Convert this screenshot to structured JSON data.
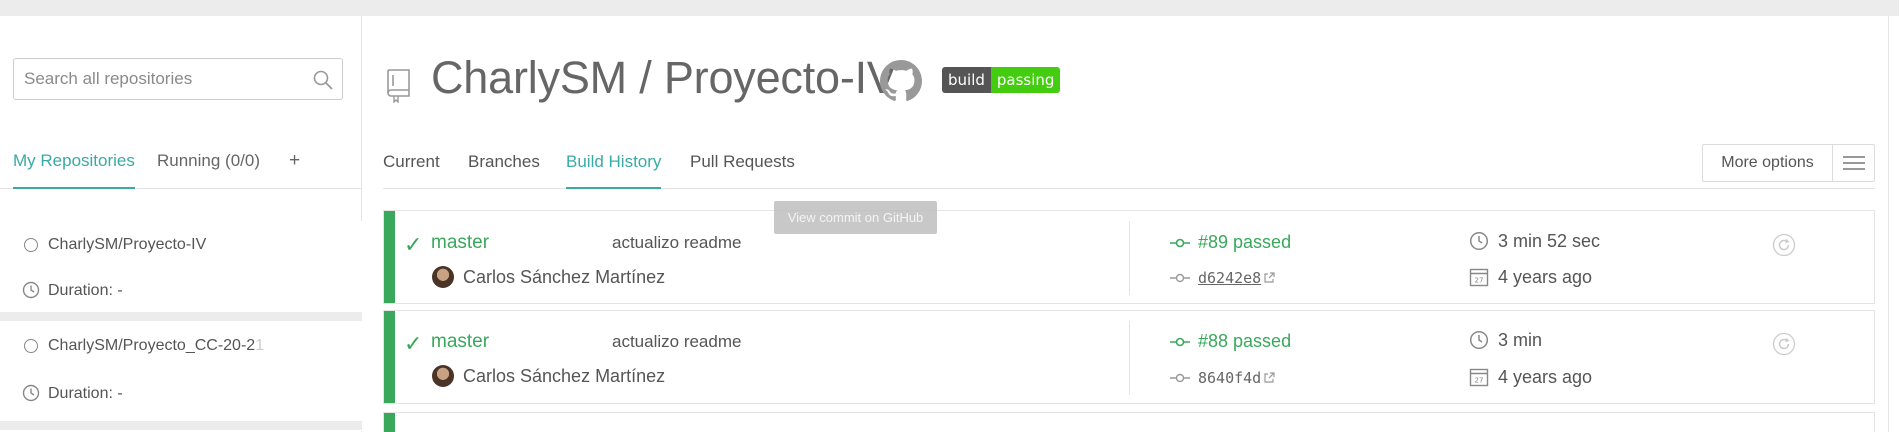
{
  "search": {
    "placeholder": "Search all repositories"
  },
  "sidebar": {
    "tabs": [
      {
        "label": "My Repositories"
      },
      {
        "label": "Running (0/0)"
      },
      {
        "label": "+"
      }
    ],
    "repos": [
      {
        "name": "CharlySM/Proyecto-IV",
        "duration": "Duration: -"
      },
      {
        "name": "CharlySM/Proyecto_CC-20-2",
        "name_fade": "1",
        "duration": "Duration: -"
      }
    ]
  },
  "header": {
    "title": "CharlySM / Proyecto-IV",
    "badge_left": "build",
    "badge_right": "passing"
  },
  "tabs": [
    {
      "label": "Current"
    },
    {
      "label": "Branches"
    },
    {
      "label": "Build History"
    },
    {
      "label": "Pull Requests"
    }
  ],
  "more_options": {
    "label": "More options"
  },
  "tooltip": "View commit on GitHub",
  "builds": [
    {
      "branch": "master",
      "message": "actualizo readme",
      "author": "Carlos Sánchez Martínez",
      "number": "#89 passed",
      "sha": "d6242e8",
      "duration": "3 min 52 sec",
      "when": "4 years ago"
    },
    {
      "branch": "master",
      "message": "actualizo readme",
      "author": "Carlos Sánchez Martínez",
      "number": "#88 passed",
      "sha": "8640f4d",
      "duration": "3 min",
      "when": "4 years ago"
    }
  ],
  "colors": {
    "accent": "#39aaa4",
    "passed": "#39a85b",
    "badge_green": "#44cc11"
  }
}
